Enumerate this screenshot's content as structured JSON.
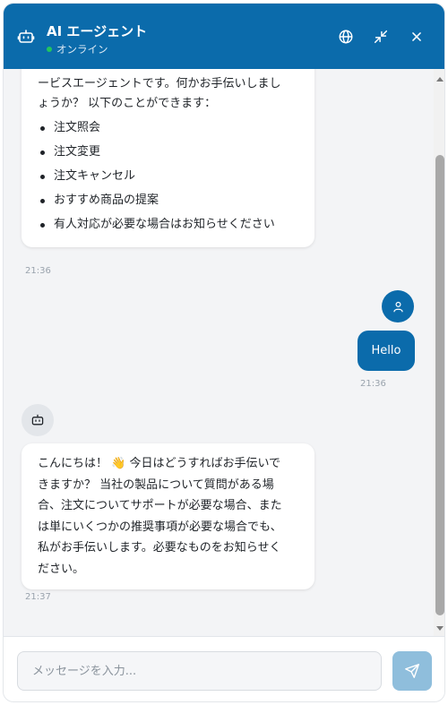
{
  "header": {
    "title": "AI エージェント",
    "status": "オンライン",
    "icons": [
      "robot-icon",
      "globe-icon",
      "minimize-icon",
      "close-icon"
    ]
  },
  "messages": [
    {
      "role": "bot",
      "lines": [
        "ービスエージェントです。何かお手伝いしまし",
        "ょうか？ 以下のことができます："
      ],
      "list": [
        "注文照会",
        "注文変更",
        "注文キャンセル",
        "おすすめ商品の提案",
        "有人対応が必要な場合はお知らせください"
      ],
      "time": "21:36"
    },
    {
      "role": "user",
      "text": "Hello",
      "time": "21:36"
    },
    {
      "role": "bot",
      "lines": [
        "こんにちは！ 👋 今日はどうすればお手伝いで",
        "きますか？ 当社の製品について質問がある場",
        "合、注文についてサポートが必要な場合、また",
        "は単にいくつかの推奨事項が必要な場合でも、",
        "私がお手伝いします。必要なものをお知らせく",
        "ださい。"
      ],
      "time": "21:37"
    }
  ],
  "input": {
    "placeholder": "メッセージを入力..."
  },
  "colors": {
    "primary": "#0b6bab",
    "send_disabled": "#8fbedc",
    "online": "#22c55e"
  }
}
